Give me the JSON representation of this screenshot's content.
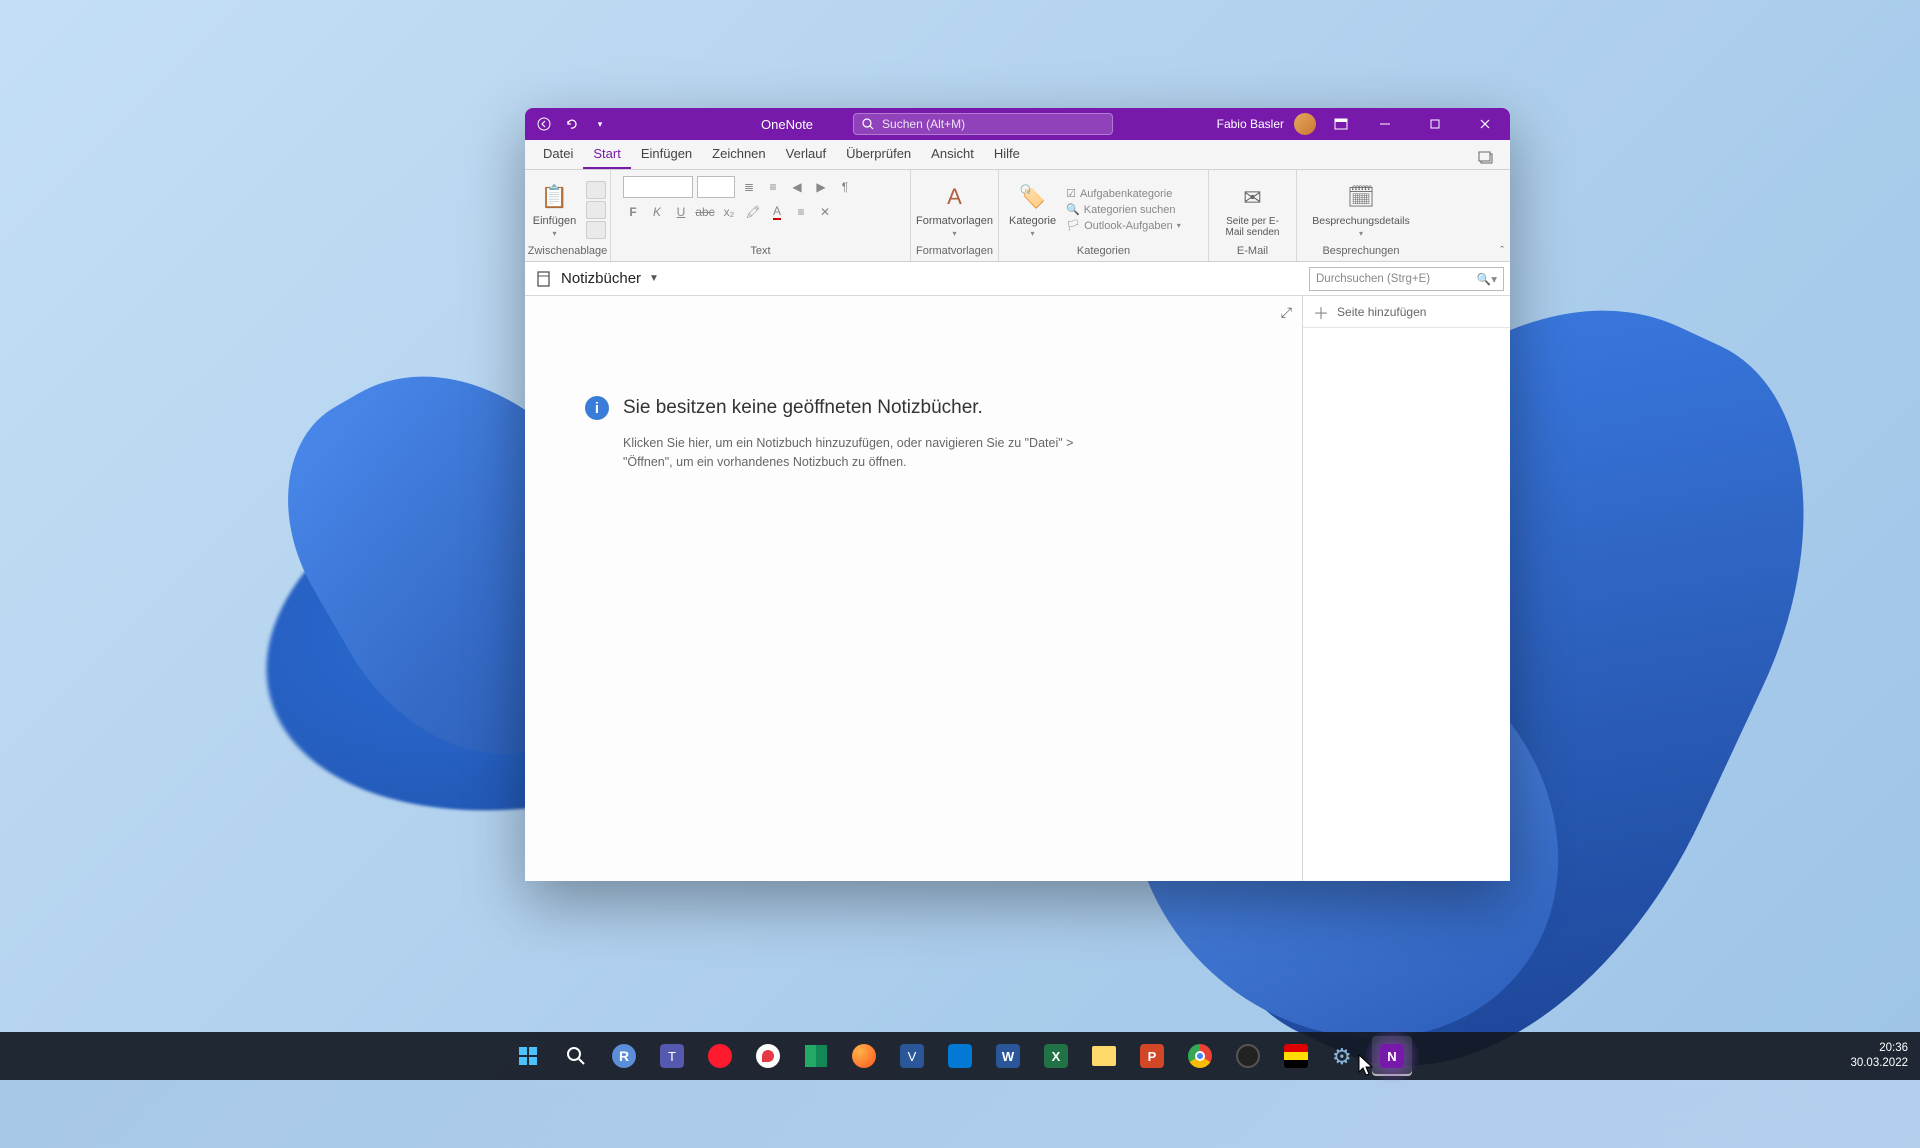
{
  "app": {
    "name": "OneNote"
  },
  "search": {
    "placeholder": "Suchen (Alt+M)"
  },
  "user": {
    "name": "Fabio Basler"
  },
  "tabs": {
    "datei": "Datei",
    "start": "Start",
    "einfuegen": "Einfügen",
    "zeichnen": "Zeichnen",
    "verlauf": "Verlauf",
    "ueberpruefen": "Überprüfen",
    "ansicht": "Ansicht",
    "hilfe": "Hilfe"
  },
  "ribbon": {
    "clipboard": {
      "paste": "Einfügen",
      "group": "Zwischenablage"
    },
    "text": {
      "group": "Text"
    },
    "styles": {
      "btn": "Formatvorlagen",
      "group": "Formatvorlagen"
    },
    "categories": {
      "btn": "Kategorie",
      "task_category": "Aufgabenkategorie",
      "search_categories": "Kategorien suchen",
      "outlook_tasks": "Outlook-Aufgaben",
      "group": "Kategorien"
    },
    "email": {
      "btn": "Seite per E-Mail senden",
      "group": "E-Mail"
    },
    "meetings": {
      "btn": "Besprechungsdetails",
      "group": "Besprechungen"
    }
  },
  "notebook_bar": {
    "label": "Notizbücher",
    "search": "Durchsuchen (Strg+E)"
  },
  "content": {
    "heading": "Sie besitzen keine geöffneten Notizbücher.",
    "description": "Klicken Sie hier, um ein Notizbuch hinzuzufügen, oder navigieren Sie zu \"Datei\" > \"Öffnen\", um ein vorhandenes Notizbuch zu öffnen."
  },
  "side": {
    "add_page": "Seite hinzufügen"
  },
  "tray": {
    "time": "20:36",
    "date": "30.03.2022"
  }
}
